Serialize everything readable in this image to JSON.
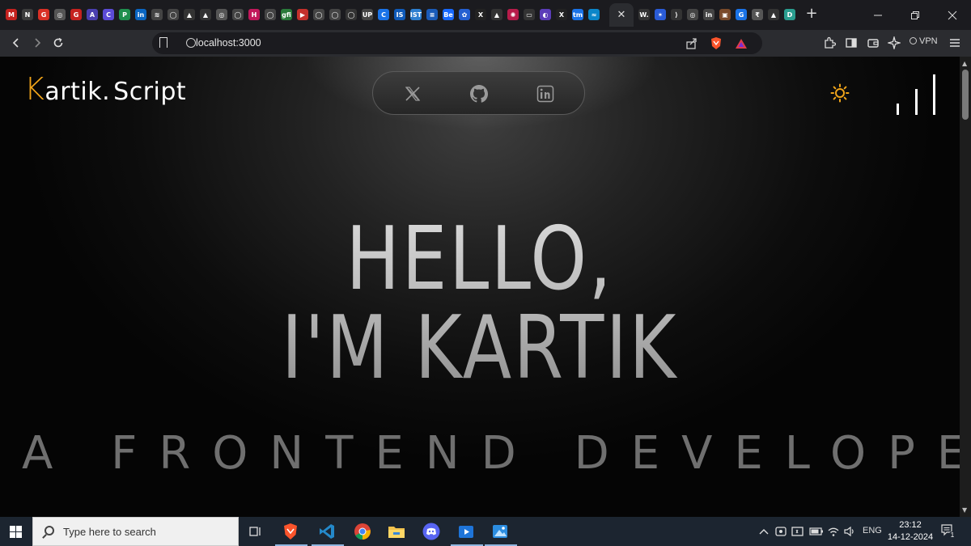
{
  "browser": {
    "url": "localhost:3000",
    "active_tab_close": "✕",
    "new_tab": "+",
    "vpn_label": "VPN",
    "tab_favicons": [
      "M",
      "N",
      "G",
      "◎",
      "G",
      "A",
      "C",
      "P",
      "in",
      "≋",
      "◯",
      "▲",
      "▲",
      "◎",
      "◯",
      "H",
      "◯",
      "gfi",
      "▶",
      "◯",
      "◯",
      "◯",
      "UP",
      "C",
      "IS",
      "IST",
      "≡",
      "Be",
      "✿",
      "X",
      "▲",
      "✺",
      "▭",
      "◐",
      "X",
      "tm",
      "≈"
    ],
    "tab_favicons_right": [
      "W.",
      "✶",
      "⟩",
      "◎",
      "in",
      "▣",
      "G",
      "₹",
      "▲",
      "D"
    ]
  },
  "site": {
    "logo_first": "K",
    "logo_rest": "artik",
    "logo_dot": ".",
    "logo_script": "Script",
    "hero_line1": "HELLO,",
    "hero_line2": "I'M KARTIK",
    "role": "A FRONTEND DEVELOPER",
    "social": [
      "X",
      "GitHub",
      "LinkedIn"
    ]
  },
  "taskbar": {
    "search_placeholder": "Type here to search",
    "lang": "ENG",
    "time": "23:12",
    "date": "14-12-2024",
    "notif_count": "1"
  },
  "colors": {
    "accent": "#f0a41a",
    "page_bg": "#000000",
    "taskbar": "#1c2530"
  }
}
